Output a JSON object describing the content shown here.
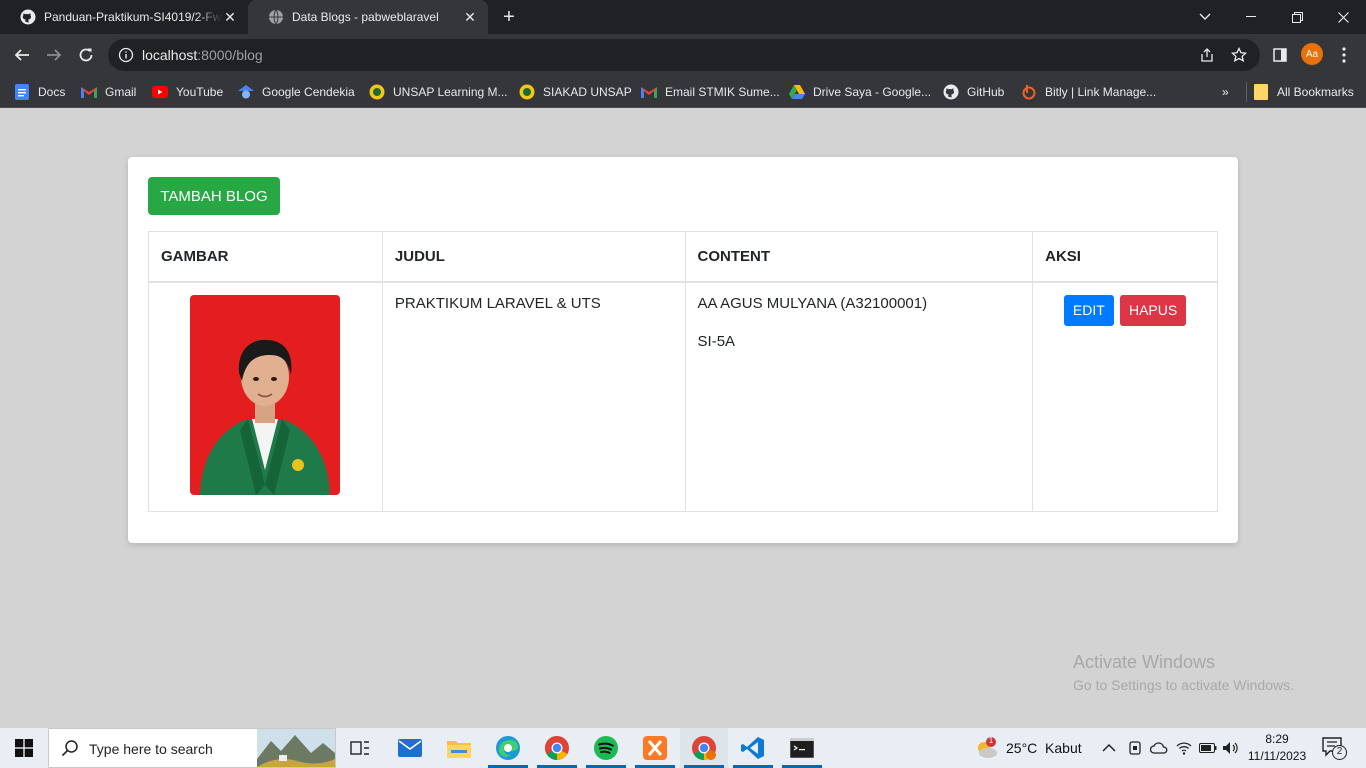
{
  "browser": {
    "tabs": [
      {
        "title": "Panduan-Praktikum-SI4019/2-Fw"
      },
      {
        "title": "Data Blogs - pabweblaravel"
      }
    ],
    "url_host": "localhost",
    "url_path": ":8000/blog",
    "profile_initials": "Aa",
    "bookmarks": [
      {
        "label": "Docs",
        "icon": "docs-icon"
      },
      {
        "label": "Gmail",
        "icon": "gmail-icon"
      },
      {
        "label": "YouTube",
        "icon": "youtube-icon"
      },
      {
        "label": "Google Cendekia",
        "icon": "scholar-icon"
      },
      {
        "label": "UNSAP Learning M...",
        "icon": "unsap-icon"
      },
      {
        "label": "SIAKAD UNSAP",
        "icon": "unsap-icon"
      },
      {
        "label": "Email STMIK Sume...",
        "icon": "gmail-icon"
      },
      {
        "label": "Drive Saya - Google...",
        "icon": "drive-icon"
      },
      {
        "label": "GitHub",
        "icon": "github-icon"
      },
      {
        "label": "Bitly | Link Manage...",
        "icon": "bitly-icon"
      }
    ],
    "all_bookmarks": "All Bookmarks"
  },
  "page": {
    "add_button": "TAMBAH BLOG",
    "table": {
      "headers": [
        "GAMBAR",
        "JUDUL",
        "CONTENT",
        "AKSI"
      ],
      "rows": [
        {
          "judul": "PRAKTIKUM LARAVEL & UTS",
          "content_line1": "AA AGUS MULYANA (A32100001)",
          "content_line2": "SI-5A",
          "edit_label": "EDIT",
          "delete_label": "HAPUS"
        }
      ]
    }
  },
  "watermark": {
    "title": "Activate Windows",
    "subtitle": "Go to Settings to activate Windows."
  },
  "taskbar": {
    "search_placeholder": "Type here to search",
    "weather": "25°C  Kabut",
    "weather_badge": "1",
    "time": "8:29",
    "date": "11/11/2023",
    "notification_count": "2"
  },
  "colors": {
    "add_button": "#28a745",
    "edit_button": "#007bff",
    "delete_button": "#dc3545",
    "photo_background": "#e41e1e"
  }
}
